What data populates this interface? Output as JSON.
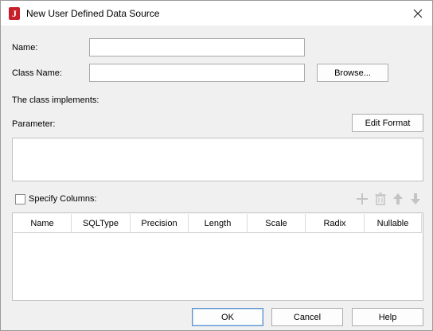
{
  "window": {
    "title": "New User Defined Data Source",
    "app_icon_letter": "J"
  },
  "form": {
    "name_label": "Name:",
    "name_value": "",
    "class_name_label": "Class Name:",
    "class_name_value": "",
    "browse_label": "Browse...",
    "implements_label": "The class implements:",
    "parameter_label": "Parameter:",
    "edit_format_label": "Edit Format"
  },
  "columns_section": {
    "specify_columns_label": "Specify Columns:",
    "specify_columns_checked": false,
    "toolbar_icons": [
      "add-icon",
      "delete-icon",
      "move-up-icon",
      "move-down-icon"
    ],
    "table_headers": [
      "Name",
      "SQLType",
      "Precision",
      "Length",
      "Scale",
      "Radix",
      "Nullable"
    ],
    "rows": []
  },
  "footer": {
    "ok_label": "OK",
    "cancel_label": "Cancel",
    "help_label": "Help"
  },
  "colors": {
    "app_icon": "#c8202a",
    "dialog_bg": "#f0f0f0",
    "default_button_border": "#5a8fd0",
    "disabled_icon": "#c0c0c0"
  }
}
